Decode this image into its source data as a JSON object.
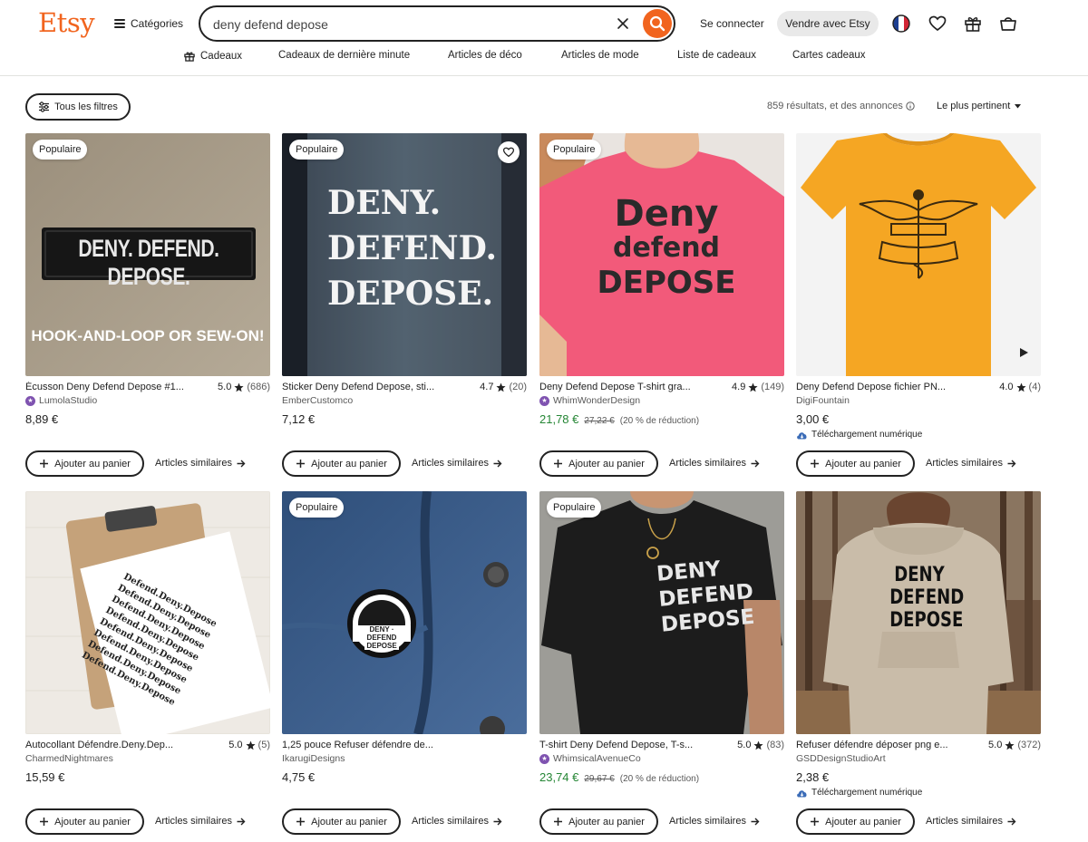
{
  "header": {
    "logo": "Etsy",
    "categories_label": "Catégories",
    "search": {
      "value": "deny defend depose",
      "placeholder": ""
    },
    "signin_label": "Se connecter",
    "sell_label": "Vendre avec Etsy",
    "icons": [
      "flag-france-icon",
      "heart-icon",
      "gift-icon",
      "cart-icon"
    ]
  },
  "category_nav": [
    {
      "label": "Cadeaux",
      "icon": "gift-icon"
    },
    {
      "label": "Cadeaux de dernière minute"
    },
    {
      "label": "Articles de déco"
    },
    {
      "label": "Articles de mode"
    },
    {
      "label": "Liste de cadeaux"
    },
    {
      "label": "Cartes cadeaux"
    }
  ],
  "filters": {
    "all_filters_label": "Tous les filtres",
    "results_text": "859 résultats, et des annonces",
    "sort_label": "Le plus pertinent"
  },
  "listings": [
    {
      "badge": "Populaire",
      "image_text": [
        "DENY. DEFEND. DEPOSE.",
        "HOOK-AND-LOOP OR SEW-ON!"
      ],
      "title": "Écusson Deny Defend Depose #1...",
      "rating": "5.0",
      "reviews": "(686)",
      "shop": "LumolaStudio",
      "star_seller": true,
      "price": "8,89 €",
      "add_label": "Ajouter au panier",
      "similar_label": "Articles similaires"
    },
    {
      "badge": "Populaire",
      "image_text": [
        "DENY.",
        "DEFEND.",
        "DEPOSE."
      ],
      "title": "Sticker Deny Defend Depose, sti...",
      "rating": "4.7",
      "reviews": "(20)",
      "shop": "EmberCustomco",
      "star_seller": false,
      "price": "7,12 €",
      "add_label": "Ajouter au panier",
      "similar_label": "Articles similaires"
    },
    {
      "badge": "Populaire",
      "image_text": [
        "Deny",
        "defend",
        "DEPOSE"
      ],
      "title": "Deny Defend Depose T-shirt gra...",
      "rating": "4.9",
      "reviews": "(149)",
      "shop": "WhimWonderDesign",
      "star_seller": true,
      "price": "21,78 €",
      "original_price": "27,22 €",
      "discount": "(20 % de réduction)",
      "add_label": "Ajouter au panier",
      "similar_label": "Articles similaires"
    },
    {
      "badge": "",
      "image_text": [],
      "title": "Deny Defend Depose fichier PN...",
      "rating": "4.0",
      "reviews": "(4)",
      "shop": "DigiFountain",
      "star_seller": false,
      "price": "3,00 €",
      "download": "Téléchargement numérique",
      "add_label": "Ajouter au panier",
      "similar_label": "Articles similaires"
    },
    {
      "badge": "",
      "image_text": [
        "Defend.Deny.Depose"
      ],
      "title": "Autocollant Défendre.Deny.Dep...",
      "rating": "5.0",
      "reviews": "(5)",
      "shop": "CharmedNightmares",
      "star_seller": false,
      "price": "15,59 €",
      "add_label": "Ajouter au panier",
      "similar_label": "Articles similaires"
    },
    {
      "badge": "Populaire",
      "image_text": [
        "DENY · DEFEND",
        "DEPOSE"
      ],
      "title": "1,25 pouce Refuser défendre de...",
      "rating": "",
      "reviews": "",
      "shop": "IkarugiDesigns",
      "star_seller": false,
      "price": "4,75 €",
      "add_label": "Ajouter au panier",
      "similar_label": "Articles similaires"
    },
    {
      "badge": "Populaire",
      "image_text": [
        "DENY",
        "DEFEND",
        "DEPOSE"
      ],
      "title": "T-shirt Deny Defend Depose, T-s...",
      "rating": "5.0",
      "reviews": "(83)",
      "shop": "WhimsicalAvenueCo",
      "star_seller": true,
      "price": "23,74 €",
      "original_price": "29,67 €",
      "discount": "(20 % de réduction)",
      "add_label": "Ajouter au panier",
      "similar_label": "Articles similaires"
    },
    {
      "badge": "",
      "image_text": [
        "DENY",
        "DEFEND",
        "DEPOSE"
      ],
      "title": "Refuser défendre déposer png e...",
      "rating": "5.0",
      "reviews": "(372)",
      "shop": "GSDDesignStudioArt",
      "star_seller": false,
      "price": "2,38 €",
      "download": "Téléchargement numérique",
      "add_label": "Ajouter au panier",
      "similar_label": "Articles similaires"
    }
  ],
  "colors": {
    "brand": "#f1641e",
    "sale": "#258635",
    "star_seller": "#7f53b0"
  }
}
